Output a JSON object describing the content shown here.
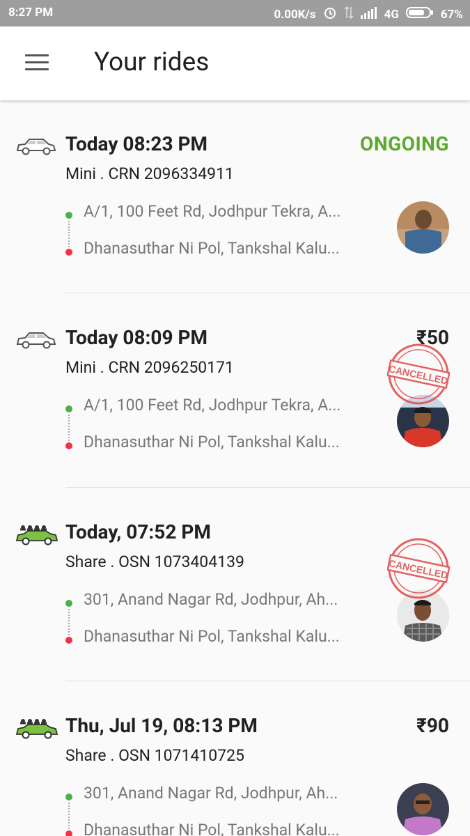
{
  "status_bar": {
    "time": "8:27 PM",
    "speed": "0.00K/s",
    "network": "4G",
    "battery": "67%"
  },
  "app_bar": {
    "title": "Your rides"
  },
  "rides": [
    {
      "datetime": "Today 08:23 PM",
      "sub": "Mini . CRN 2096334911",
      "right_value": "ONGOING",
      "from": "A/1, 100 Feet Rd, Jodhpur Tekra, A...",
      "to": "Dhanasuthar Ni Pol, Tankshal Kalu...",
      "car": "sedan-car-icon",
      "cancelled": false
    },
    {
      "datetime": "Today 08:09 PM",
      "sub": "Mini . CRN 2096250171",
      "right_value": "₹50",
      "from": "A/1, 100 Feet Rd, Jodhpur Tekra, A...",
      "to": "Dhanasuthar Ni Pol, Tankshal Kalu...",
      "car": "sedan-car-icon",
      "cancelled": true
    },
    {
      "datetime": "Today, 07:52 PM",
      "sub": "Share . OSN 1073404139",
      "right_value": "",
      "from": "301, Anand Nagar Rd, Jodhpur, Ah...",
      "to": "Dhanasuthar Ni Pol, Tankshal Kalu...",
      "car": "share-car-icon",
      "cancelled": true
    },
    {
      "datetime": "Thu, Jul 19, 08:13 PM",
      "sub": "Share . OSN 1071410725",
      "right_value": "₹90",
      "from": "301, Anand Nagar Rd, Jodhpur, Ah...",
      "to": "Dhanasuthar Ni Pol, Tankshal Kalu...",
      "car": "share-car-icon",
      "cancelled": false
    }
  ],
  "stamp_text": "CANCELLED",
  "colors": {
    "ongoing": "#5aaa2c",
    "from_dot": "#4caf50",
    "to_dot": "#f0334a",
    "stamp": "#e04848",
    "share_car": "#7cc242"
  }
}
